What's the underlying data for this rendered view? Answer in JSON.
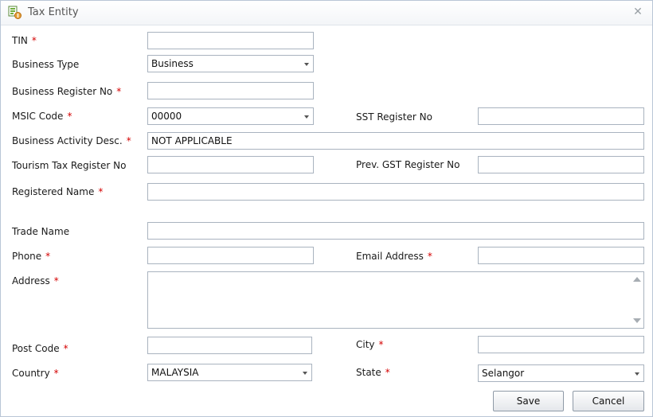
{
  "window": {
    "title": "Tax Entity",
    "close_glyph": "✕",
    "icon": "app-form-icon"
  },
  "required_mark": "*",
  "colors": {
    "required": "#d40000",
    "border": "#a9b3bf",
    "title_text": "#555555"
  },
  "form": {
    "tin": {
      "label": "TIN",
      "value": ""
    },
    "business_type": {
      "label": "Business Type",
      "value": "Business"
    },
    "business_register_no": {
      "label": "Business Register No",
      "value": ""
    },
    "msic_code": {
      "label": "MSIC Code",
      "value": "00000"
    },
    "sst_register_no": {
      "label": "SST Register No",
      "value": ""
    },
    "business_activity_desc": {
      "label": "Business Activity Desc.",
      "value": "NOT APPLICABLE"
    },
    "tourism_tax_register_no": {
      "label": "Tourism Tax Register No",
      "value": ""
    },
    "prev_gst_register_no": {
      "label": "Prev. GST Register No",
      "value": ""
    },
    "registered_name": {
      "label": "Registered Name",
      "value": ""
    },
    "trade_name": {
      "label": "Trade Name",
      "value": ""
    },
    "phone": {
      "label": "Phone",
      "value": ""
    },
    "email_address": {
      "label": "Email Address",
      "value": ""
    },
    "address": {
      "label": "Address",
      "value": ""
    },
    "post_code": {
      "label": "Post Code",
      "value": ""
    },
    "city": {
      "label": "City",
      "value": ""
    },
    "country": {
      "label": "Country",
      "value": "MALAYSIA"
    },
    "state": {
      "label": "State",
      "value": "Selangor"
    }
  },
  "buttons": {
    "save": "Save",
    "cancel": "Cancel"
  }
}
